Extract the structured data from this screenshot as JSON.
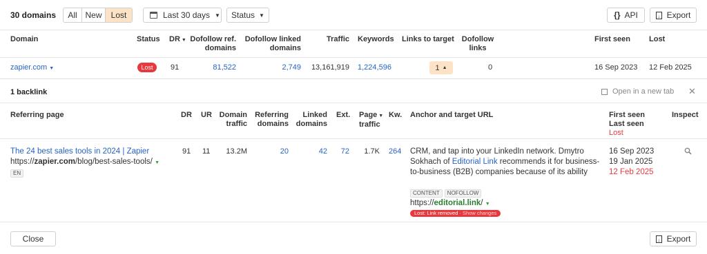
{
  "toolbar": {
    "count": "30 domains",
    "filters": [
      "All",
      "New",
      "Lost"
    ],
    "active_filter": "Lost",
    "date_range": "Last 30 days",
    "status": "Status",
    "api": "API",
    "export": "Export"
  },
  "table": {
    "headers": {
      "domain": "Domain",
      "status": "Status",
      "dr": "DR",
      "dofollow_ref_domains": [
        "Dofollow ref.",
        "domains"
      ],
      "dofollow_linked_domains": [
        "Dofollow linked",
        "domains"
      ],
      "traffic": "Traffic",
      "keywords": "Keywords",
      "links_to_target": "Links to target",
      "dofollow_links": [
        "Dofollow",
        "links"
      ],
      "first_seen": "First seen",
      "lost": "Lost"
    },
    "row": {
      "domain": "zapier.com",
      "status": "Lost",
      "dr": "91",
      "dofollow_ref_domains": "81,522",
      "dofollow_linked_domains": "2,749",
      "traffic": "13,161,919",
      "keywords": "1,224,596",
      "links_to_target": "1",
      "dofollow_links": "0",
      "first_seen": "16 Sep 2023",
      "lost": "12 Feb 2025"
    }
  },
  "detail": {
    "title": "1 backlink",
    "open_new_tab": "Open in a new tab",
    "headers": {
      "referring_page": "Referring page",
      "dr": "DR",
      "ur": "UR",
      "domain_traffic": [
        "Domain",
        "traffic"
      ],
      "referring_domains": [
        "Referring",
        "domains"
      ],
      "linked_domains": [
        "Linked",
        "domains"
      ],
      "ext": "Ext.",
      "page_traffic": [
        "Page",
        "traffic"
      ],
      "kw": "Kw.",
      "anchor": "Anchor and target URL",
      "first_seen": "First seen",
      "last_seen": "Last seen",
      "lost": "Lost",
      "inspect": "Inspect"
    },
    "row": {
      "page_title": "The 24 best sales tools in 2024 | Zapier",
      "url_prefix": "https://",
      "url_domain": "zapier.com",
      "url_path": "/blog/best-sales-tools/",
      "lang": "EN",
      "dr": "91",
      "ur": "11",
      "domain_traffic": "13.2M",
      "referring_domains": "20",
      "linked_domains": "42",
      "ext": "72",
      "page_traffic": "1.7K",
      "kw": "264",
      "anchor_before": "CRM, and tap into your LinkedIn network. Dmytro Sokhach of ",
      "anchor_link": "Editorial Link",
      "anchor_after": " recommends it for business-to-business (B2B) companies because of its ability",
      "tags": [
        "CONTENT",
        "NOFOLLOW"
      ],
      "target_prefix": "https://",
      "target_domain": "editorial.link",
      "target_path": "/",
      "lost_badge": "Lost: Link removed",
      "show_changes": " · Show changes",
      "first_seen": "16 Sep 2023",
      "last_seen": "19 Jan 2025",
      "lost": "12 Feb 2025"
    }
  },
  "footer": {
    "close": "Close",
    "export": "Export"
  },
  "colors": {
    "link": "#2563c7",
    "lost_red": "#e8383d",
    "active_filter": "#fde3c6",
    "links_badge": "#fde3c6"
  }
}
